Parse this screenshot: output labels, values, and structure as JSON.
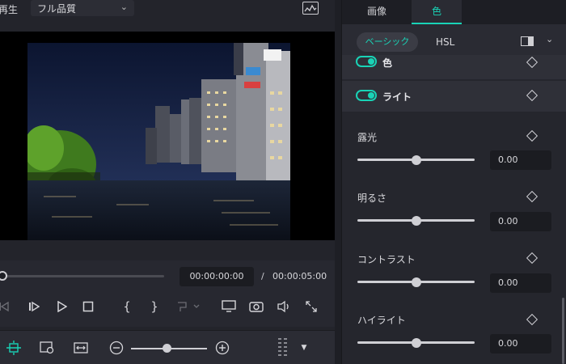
{
  "player": {
    "playback_label": "再生",
    "quality": "フル品質",
    "current_time": "00:00:00:00",
    "time_separator": "/",
    "duration": "00:00:05:00"
  },
  "panel": {
    "tabs": [
      {
        "label": "画像",
        "active": false
      },
      {
        "label": "色",
        "active": true
      }
    ],
    "subtabs": {
      "basic": "ベーシック",
      "hsl": "HSL"
    },
    "toggles": [
      {
        "label": "色",
        "on": true
      },
      {
        "label": "ライト",
        "on": true
      }
    ],
    "properties": [
      {
        "label": "露光",
        "value": "0.00",
        "level": 0.5
      },
      {
        "label": "明るさ",
        "value": "0.00",
        "level": 0.5
      },
      {
        "label": "コントラスト",
        "value": "0.00",
        "level": 0.5
      },
      {
        "label": "ハイライト",
        "value": "0.00",
        "level": 0.5
      }
    ]
  },
  "colors": {
    "accent": "#19d3b6",
    "panel_bg": "#25262d",
    "player_bg": "#23242b"
  },
  "icons": {
    "scope": "waveform-icon",
    "layout": "split-view-icon",
    "prev_frame": "step-back-icon",
    "next_frame": "step-forward-icon",
    "play": "play-icon",
    "stop": "stop-icon",
    "mark_in": "mark-in-icon",
    "mark_out": "mark-out-icon",
    "marker": "marker-icon",
    "display": "monitor-icon",
    "snapshot": "camera-icon",
    "volume": "speaker-icon",
    "fullscreen": "expand-icon"
  }
}
